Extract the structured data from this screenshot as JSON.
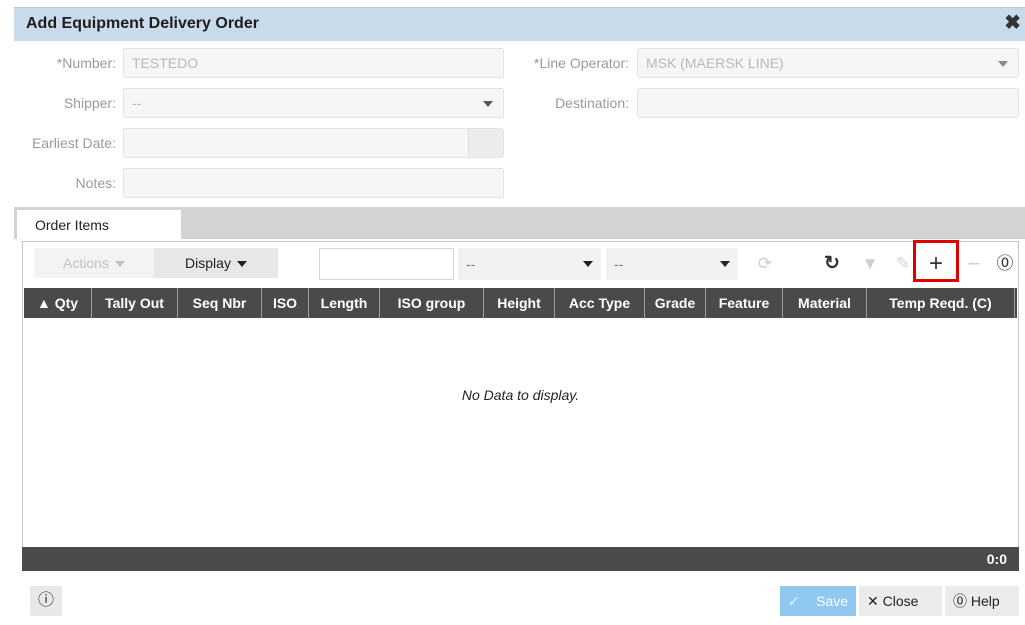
{
  "dialog": {
    "title": "Add Equipment Delivery Order"
  },
  "form": {
    "number": {
      "label": "*Number:",
      "value": "TESTEDO"
    },
    "line_operator": {
      "label": "*Line Operator:",
      "value": "MSK (MAERSK LINE)"
    },
    "shipper": {
      "label": "Shipper:",
      "value": "--"
    },
    "destination": {
      "label": "Destination:",
      "value": ""
    },
    "earliest_date": {
      "label": "Earliest Date:",
      "value": ""
    },
    "notes": {
      "label": "Notes:",
      "value": ""
    }
  },
  "tabs": [
    {
      "label": "Order Items"
    }
  ],
  "toolbar": {
    "actions_label": "Actions",
    "display_label": "Display",
    "filter_value": "",
    "select1_value": "--",
    "select2_value": "--"
  },
  "table": {
    "columns": [
      "Qty",
      "Tally Out",
      "Seq Nbr",
      "ISO",
      "Length",
      "ISO group",
      "Height",
      "Acc Type",
      "Grade",
      "Feature",
      "Material",
      "Temp Reqd. (C)"
    ],
    "sort_indicator": "▲",
    "empty_message": "No Data to display.",
    "count": "0:0"
  },
  "footer": {
    "save_label": "Save",
    "close_label": "Close",
    "help_label": "Help"
  }
}
